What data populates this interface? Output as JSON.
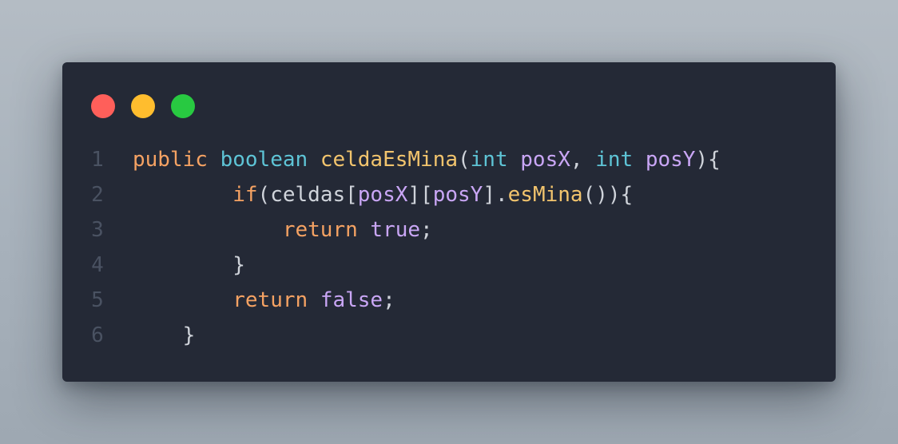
{
  "colors": {
    "background": "#a8b2bc",
    "window": "#242936",
    "close": "#ff5f5a",
    "minimize": "#ffbd2e",
    "maximize": "#28c941",
    "keyword": "#f5a263",
    "type": "#5ec4d6",
    "function": "#f2c46d",
    "variable": "#c9a6f5",
    "punctuation": "#cfd3da",
    "line_number": "#4a5262"
  },
  "window_controls": [
    {
      "name": "close",
      "color": "#ff5f5a"
    },
    {
      "name": "minimize",
      "color": "#ffbd2e"
    },
    {
      "name": "maximize",
      "color": "#28c941"
    }
  ],
  "code": {
    "language": "java",
    "lines": [
      {
        "number": "1",
        "indent": "",
        "tokens": [
          {
            "text": "public",
            "kind": "kw"
          },
          {
            "text": " ",
            "kind": "pu"
          },
          {
            "text": "boolean",
            "kind": "ty"
          },
          {
            "text": " ",
            "kind": "pu"
          },
          {
            "text": "celdaEsMina",
            "kind": "fn"
          },
          {
            "text": "(",
            "kind": "pu"
          },
          {
            "text": "int",
            "kind": "ty"
          },
          {
            "text": " ",
            "kind": "pu"
          },
          {
            "text": "posX",
            "kind": "va"
          },
          {
            "text": ", ",
            "kind": "pu"
          },
          {
            "text": "int",
            "kind": "ty"
          },
          {
            "text": " ",
            "kind": "pu"
          },
          {
            "text": "posY",
            "kind": "va"
          },
          {
            "text": "){",
            "kind": "pu"
          }
        ]
      },
      {
        "number": "2",
        "indent": "        ",
        "tokens": [
          {
            "text": "if",
            "kind": "kw"
          },
          {
            "text": "(celdas[",
            "kind": "pu"
          },
          {
            "text": "posX",
            "kind": "va"
          },
          {
            "text": "][",
            "kind": "pu"
          },
          {
            "text": "posY",
            "kind": "va"
          },
          {
            "text": "].",
            "kind": "pu"
          },
          {
            "text": "esMina",
            "kind": "fn"
          },
          {
            "text": "()){",
            "kind": "pu"
          }
        ]
      },
      {
        "number": "3",
        "indent": "            ",
        "tokens": [
          {
            "text": "return",
            "kind": "kw"
          },
          {
            "text": " ",
            "kind": "pu"
          },
          {
            "text": "true",
            "kind": "va"
          },
          {
            "text": ";",
            "kind": "pu"
          }
        ]
      },
      {
        "number": "4",
        "indent": "        ",
        "tokens": [
          {
            "text": "}",
            "kind": "pu"
          }
        ]
      },
      {
        "number": "5",
        "indent": "        ",
        "tokens": [
          {
            "text": "return",
            "kind": "kw"
          },
          {
            "text": " ",
            "kind": "pu"
          },
          {
            "text": "false",
            "kind": "va"
          },
          {
            "text": ";",
            "kind": "pu"
          }
        ]
      },
      {
        "number": "6",
        "indent": "    ",
        "tokens": [
          {
            "text": "}",
            "kind": "pu"
          }
        ]
      }
    ]
  }
}
